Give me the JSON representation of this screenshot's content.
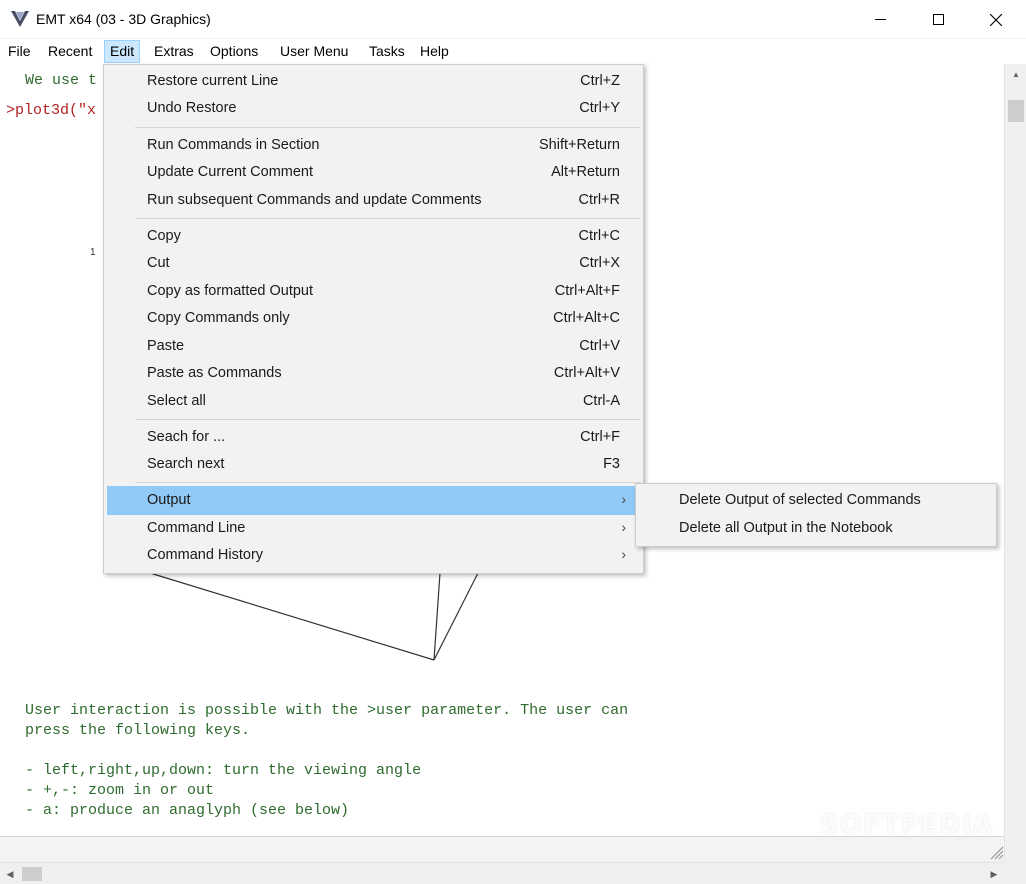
{
  "window": {
    "title": "EMT x64 (03 - 3D Graphics)",
    "icons": {
      "app": "emt-app-icon",
      "minimize": "minimize-icon",
      "maximize": "maximize-icon",
      "close": "close-icon"
    }
  },
  "menubar": {
    "items": [
      {
        "label": "File"
      },
      {
        "label": "Recent"
      },
      {
        "label": "Edit",
        "active": true
      },
      {
        "label": "Extras"
      },
      {
        "label": "Options"
      },
      {
        "label": "User Menu"
      },
      {
        "label": "Tasks"
      },
      {
        "label": "Help"
      }
    ]
  },
  "notebook": {
    "intro_comment": "We use t",
    "command_prompt": ">plot3d(\"x",
    "plot_tick_label": "1",
    "comment_lines": [
      "User interaction is possible with the >user parameter. The user can",
      "press the following keys.",
      "",
      "- left,right,up,down: turn the viewing angle",
      "- +,-: zoom in or out",
      "- a: produce an anaglyph (see below)"
    ]
  },
  "edit_menu": {
    "items": [
      {
        "label": "Restore current Line",
        "shortcut": "Ctrl+Z"
      },
      {
        "label": "Undo Restore",
        "shortcut": "Ctrl+Y"
      },
      {
        "label": "Run Commands in Section",
        "shortcut": "Shift+Return"
      },
      {
        "label": "Update Current Comment",
        "shortcut": "Alt+Return"
      },
      {
        "label": "Run subsequent Commands and update Comments",
        "shortcut": "Ctrl+R"
      },
      {
        "label": "Copy",
        "shortcut": "Ctrl+C"
      },
      {
        "label": "Cut",
        "shortcut": "Ctrl+X"
      },
      {
        "label": "Copy as formatted Output",
        "shortcut": "Ctrl+Alt+F"
      },
      {
        "label": "Copy Commands only",
        "shortcut": "Ctrl+Alt+C"
      },
      {
        "label": "Paste",
        "shortcut": "Ctrl+V"
      },
      {
        "label": "Paste as Commands",
        "shortcut": "Ctrl+Alt+V"
      },
      {
        "label": "Select all",
        "shortcut": "Ctrl-A"
      },
      {
        "label": "Seach for ...",
        "shortcut": "Ctrl+F"
      },
      {
        "label": "Search next",
        "shortcut": "F3"
      },
      {
        "label": "Output",
        "submenu": true,
        "highlighted": true
      },
      {
        "label": "Command Line",
        "submenu": true
      },
      {
        "label": "Command History",
        "submenu": true
      }
    ],
    "submenu_arrow": "›"
  },
  "output_submenu": {
    "items": [
      {
        "label": "Delete Output of selected Commands"
      },
      {
        "label": "Delete all Output in the Notebook"
      }
    ]
  },
  "watermark": "SOFTPEDIA",
  "colors": {
    "comment_text": "#2f6b2f",
    "command_text": "#b22222",
    "menu_highlight": "#91c9f7",
    "menubar_active": "#cce8ff"
  }
}
